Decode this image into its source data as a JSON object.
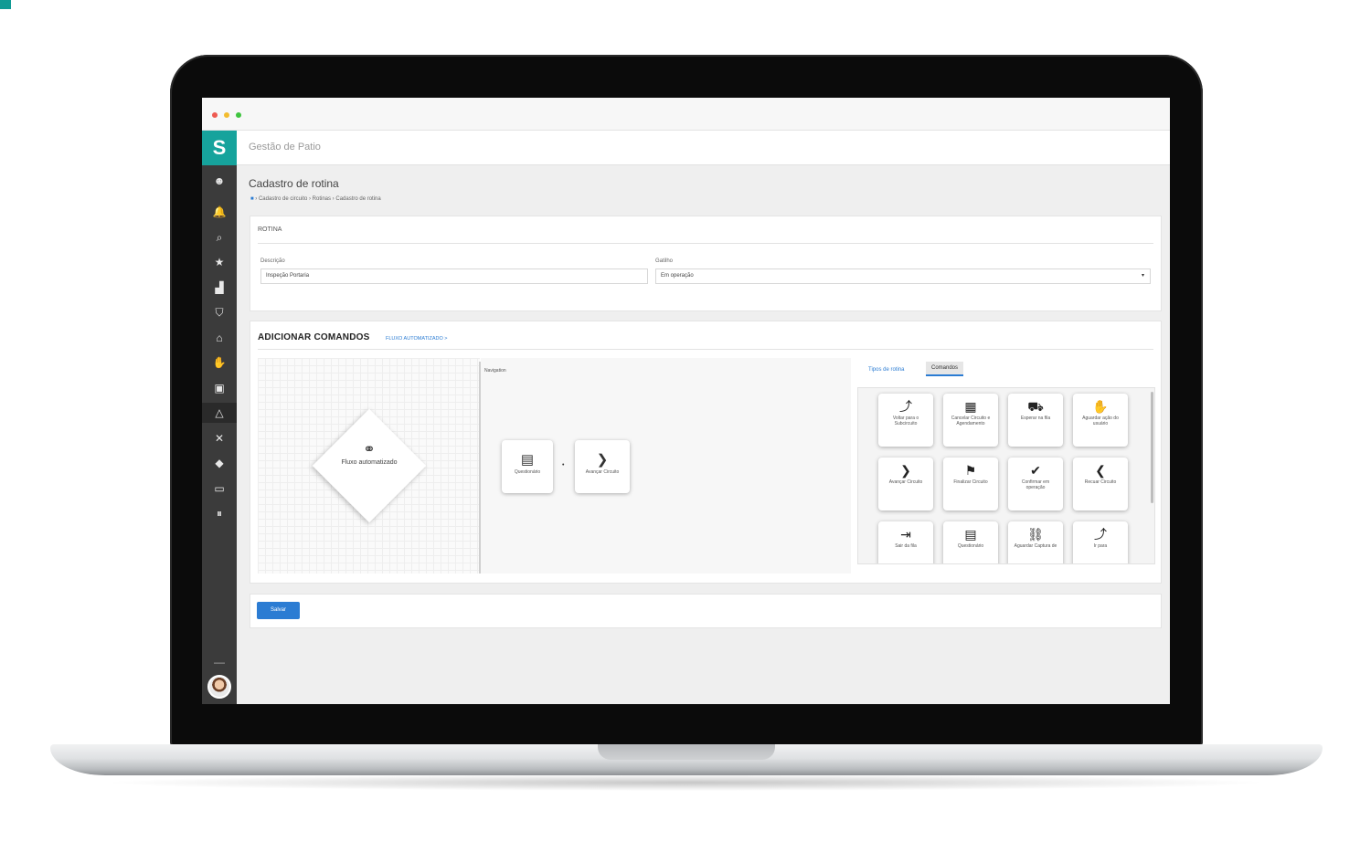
{
  "app": {
    "title": "Gestão de Patio",
    "logo_glyph": "S"
  },
  "page": {
    "title": "Cadastro de rotina",
    "breadcrumb": [
      "Cadastro de circuito",
      "Rotinas",
      "Cadastro de rotina"
    ]
  },
  "sidebar": {
    "items": [
      {
        "icon": "user-circle-icon",
        "glyph": "☻"
      },
      {
        "icon": "bell-icon",
        "glyph": "🔔"
      },
      {
        "icon": "search-icon",
        "glyph": "⌕"
      },
      {
        "icon": "star-icon",
        "glyph": "★"
      },
      {
        "icon": "chart-icon",
        "glyph": "▟"
      },
      {
        "icon": "shield-icon",
        "glyph": "⛉"
      },
      {
        "icon": "bank-icon",
        "glyph": "⌂"
      },
      {
        "icon": "handshake-icon",
        "glyph": "✋"
      },
      {
        "icon": "briefcase-icon",
        "glyph": "▣"
      },
      {
        "icon": "cone-icon",
        "glyph": "△"
      },
      {
        "icon": "tools-icon",
        "glyph": "✕"
      },
      {
        "icon": "diamond-icon",
        "glyph": "◆"
      },
      {
        "icon": "monitor-icon",
        "glyph": "▭"
      },
      {
        "icon": "pause-icon",
        "glyph": "⏸"
      }
    ],
    "collapse_glyph": "—"
  },
  "rotina": {
    "section_label": "ROTINA",
    "descricao": {
      "label": "Descrição",
      "value": "Inspeção Portaria"
    },
    "gatilho": {
      "label": "Gatilho",
      "value": "Em operação",
      "arrow": "▾"
    }
  },
  "comandos": {
    "title": "ADICIONAR COMANDOS",
    "link": "FLUXO AUTOMATIZADO >",
    "diamond_label": "Fluxo automatizado",
    "canvas_title": "Navigation",
    "flow_nodes": [
      {
        "icon": "questionnaire-icon",
        "glyph": "▤",
        "label": "Questionário"
      },
      {
        "icon": "chevron-right-icon",
        "glyph": "❯",
        "label": "Avançar Circuito"
      }
    ],
    "connector": "•",
    "tabs": [
      {
        "label": "Tipos de rotina",
        "active": false
      },
      {
        "label": "Comandos",
        "active": true
      }
    ],
    "palette": [
      {
        "icon": "subcircuit-return-icon",
        "glyph": "⤴",
        "label": "Voltar para o Subcircuito"
      },
      {
        "icon": "calendar-cancel-icon",
        "glyph": "▦",
        "label": "Cancelar Circuito e Agendamento"
      },
      {
        "icon": "truck-icon",
        "glyph": "⛟",
        "label": "Esperar na fila"
      },
      {
        "icon": "hand-icon",
        "glyph": "✋",
        "label": "Aguardar ação do usuário"
      },
      {
        "icon": "chevron-right-icon",
        "glyph": "❯",
        "label": "Avançar Circuito"
      },
      {
        "icon": "flag-icon",
        "glyph": "⚑",
        "label": "Finalizar Circuito"
      },
      {
        "icon": "check-circle-icon",
        "glyph": "✔",
        "label": "Confirmar em operação"
      },
      {
        "icon": "chevron-left-icon",
        "glyph": "❮",
        "label": "Recuar Circuito"
      },
      {
        "icon": "exit-icon",
        "glyph": "⇥",
        "label": "Sair da fila"
      },
      {
        "icon": "questionnaire-icon",
        "glyph": "▤",
        "label": "Questionário"
      },
      {
        "icon": "binoculars-icon",
        "glyph": "⛓",
        "label": "Aguardar Captura de"
      },
      {
        "icon": "branch-icon",
        "glyph": "⤴",
        "label": "Ir para"
      }
    ]
  },
  "footer": {
    "save_label": "Salvar"
  },
  "colors": {
    "accent": "#16a39c",
    "primary_blue": "#2b7cd3",
    "sidebar": "#3b3b3b"
  }
}
